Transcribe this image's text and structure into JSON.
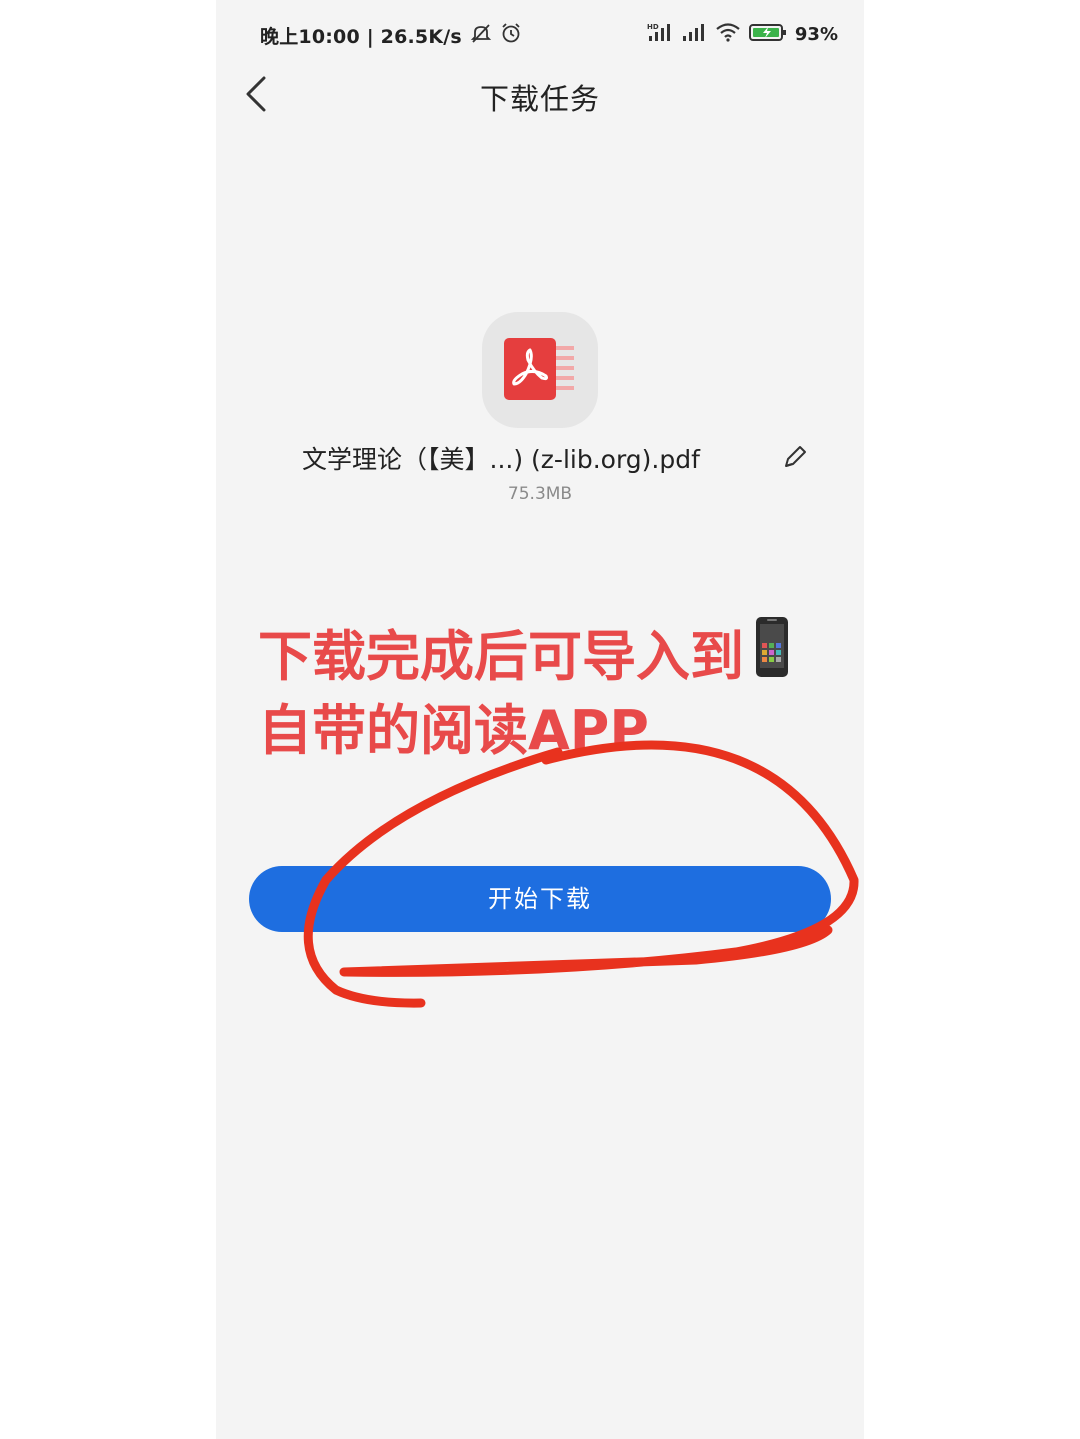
{
  "status_bar": {
    "time_speed": "晚上10:00 | 26.5K/s",
    "icons_left": [
      "bell-off-icon",
      "alarm-icon"
    ],
    "icons_right": [
      "hd-signal-icon",
      "signal-icon",
      "wifi-icon",
      "battery-charging-icon"
    ],
    "battery": "93%"
  },
  "nav": {
    "back_icon": "chevron-left-icon",
    "title": "下载任务"
  },
  "file": {
    "icon": "pdf-file-icon",
    "name": "文学理论（【美】...) (z-lib.org).pdf",
    "size": "75.3MB",
    "edit_icon": "pencil-icon"
  },
  "annotation": {
    "line1": "下载完成后可导入到",
    "line2": "自带的阅读APP",
    "emoji": "mobile-phone-icon",
    "color": "#e84a4a",
    "circle_color": "#e8321e"
  },
  "button": {
    "label": "开始下载",
    "color": "#1e6ee0"
  }
}
